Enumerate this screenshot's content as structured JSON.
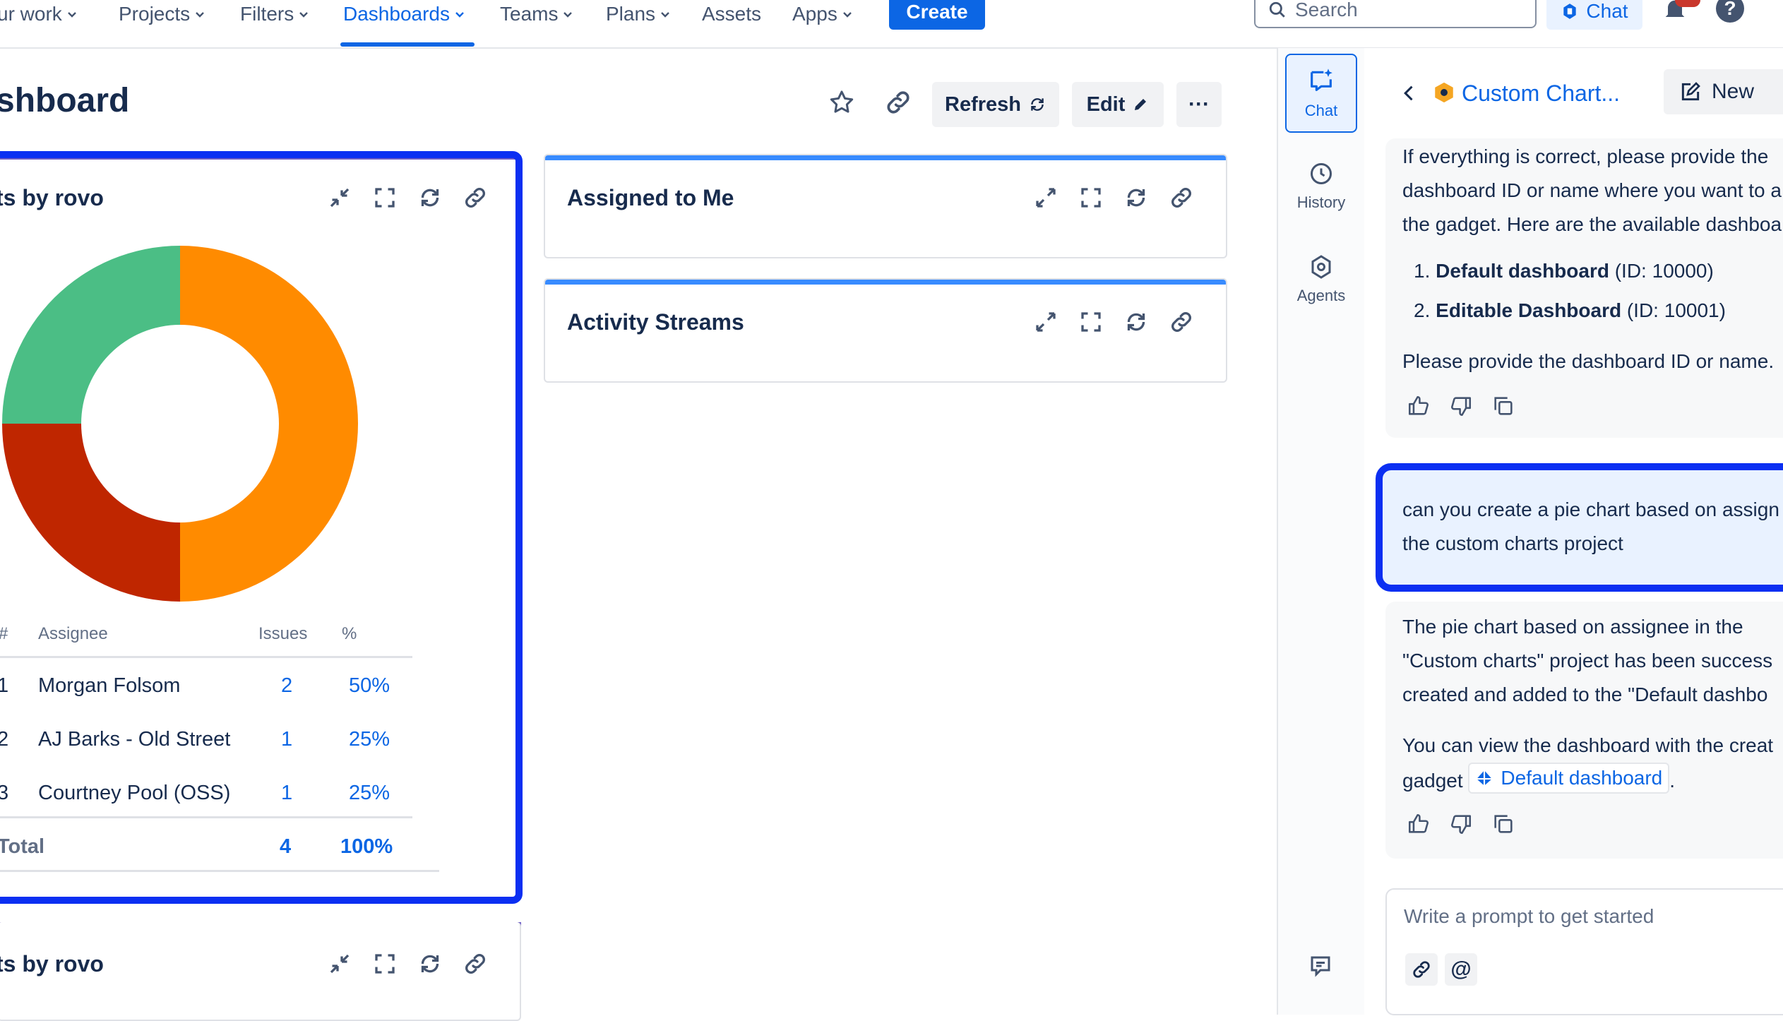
{
  "nav": {
    "items": [
      {
        "label": "ur work",
        "has_chevron": true
      },
      {
        "label": "Projects",
        "has_chevron": true
      },
      {
        "label": "Filters",
        "has_chevron": true
      },
      {
        "label": "Dashboards",
        "has_chevron": true,
        "active": true
      },
      {
        "label": "Teams",
        "has_chevron": true
      },
      {
        "label": "Plans",
        "has_chevron": true
      },
      {
        "label": "Assets",
        "has_chevron": false
      },
      {
        "label": "Apps",
        "has_chevron": true
      }
    ],
    "create_label": "Create",
    "search_placeholder": "Search",
    "chat_label": "Chat",
    "notifications_icon": "bell-icon",
    "help_label": "?"
  },
  "dashboard": {
    "title": "shboard",
    "refresh_label": "Refresh",
    "edit_label": "Edit",
    "more_label": "···"
  },
  "gadgets": {
    "pie": {
      "title": "ts by rovo",
      "chart_data": {
        "type": "pie",
        "style": "donut",
        "categories": [
          "Morgan Folsom",
          "AJ Barks - Old Street",
          "Courtney Pool (OSS)"
        ],
        "values": [
          2,
          1,
          1
        ],
        "colors": [
          "#ff8b00",
          "#bf2600",
          "#4bbe85"
        ]
      },
      "table": {
        "headers": [
          "#",
          "Assignee",
          "Issues",
          "%"
        ],
        "rows": [
          {
            "num": "1",
            "assignee": "Morgan Folsom",
            "issues": "2",
            "pct": "50%"
          },
          {
            "num": "2",
            "assignee": "AJ Barks - Old Street",
            "issues": "1",
            "pct": "25%"
          },
          {
            "num": "3",
            "assignee": "Courtney Pool (OSS)",
            "issues": "1",
            "pct": "25%"
          }
        ],
        "total_label": "Total",
        "total_issues": "4",
        "total_pct": "100%"
      }
    },
    "assigned": {
      "title": "Assigned to Me"
    },
    "activity": {
      "title": "Activity Streams"
    },
    "pie2": {
      "title": "ts by rovo"
    }
  },
  "sidenav": {
    "chat": "Chat",
    "history": "History",
    "agents": "Agents"
  },
  "chat": {
    "header_title": "Custom Chart...",
    "new_label": "New",
    "msg1_lines": [
      "If everything is correct, please provide the",
      "dashboard ID or name where you want to a",
      "the gadget. Here are the available dashboa"
    ],
    "dash_list": [
      {
        "name": "Default dashboard",
        "id": "(ID: 10000)"
      },
      {
        "name": "Editable Dashboard",
        "id": "(ID: 10001)"
      }
    ],
    "msg1_footer": "Please provide the dashboard ID or name.",
    "user_msg_lines": [
      "can you create a pie chart based on assign",
      "the custom charts project"
    ],
    "msg2_lines": [
      "The pie chart based on assignee in the",
      "\"Custom charts\" project has been success",
      "created and added to the \"Default dashbo"
    ],
    "msg3_line1": "You can view the dashboard with the creat",
    "msg3_prefix": "gadget",
    "msg3_link": "Default dashboard",
    "msg3_suffix": ".",
    "prompt_placeholder": "Write a prompt to get started",
    "mention_label": "@"
  }
}
